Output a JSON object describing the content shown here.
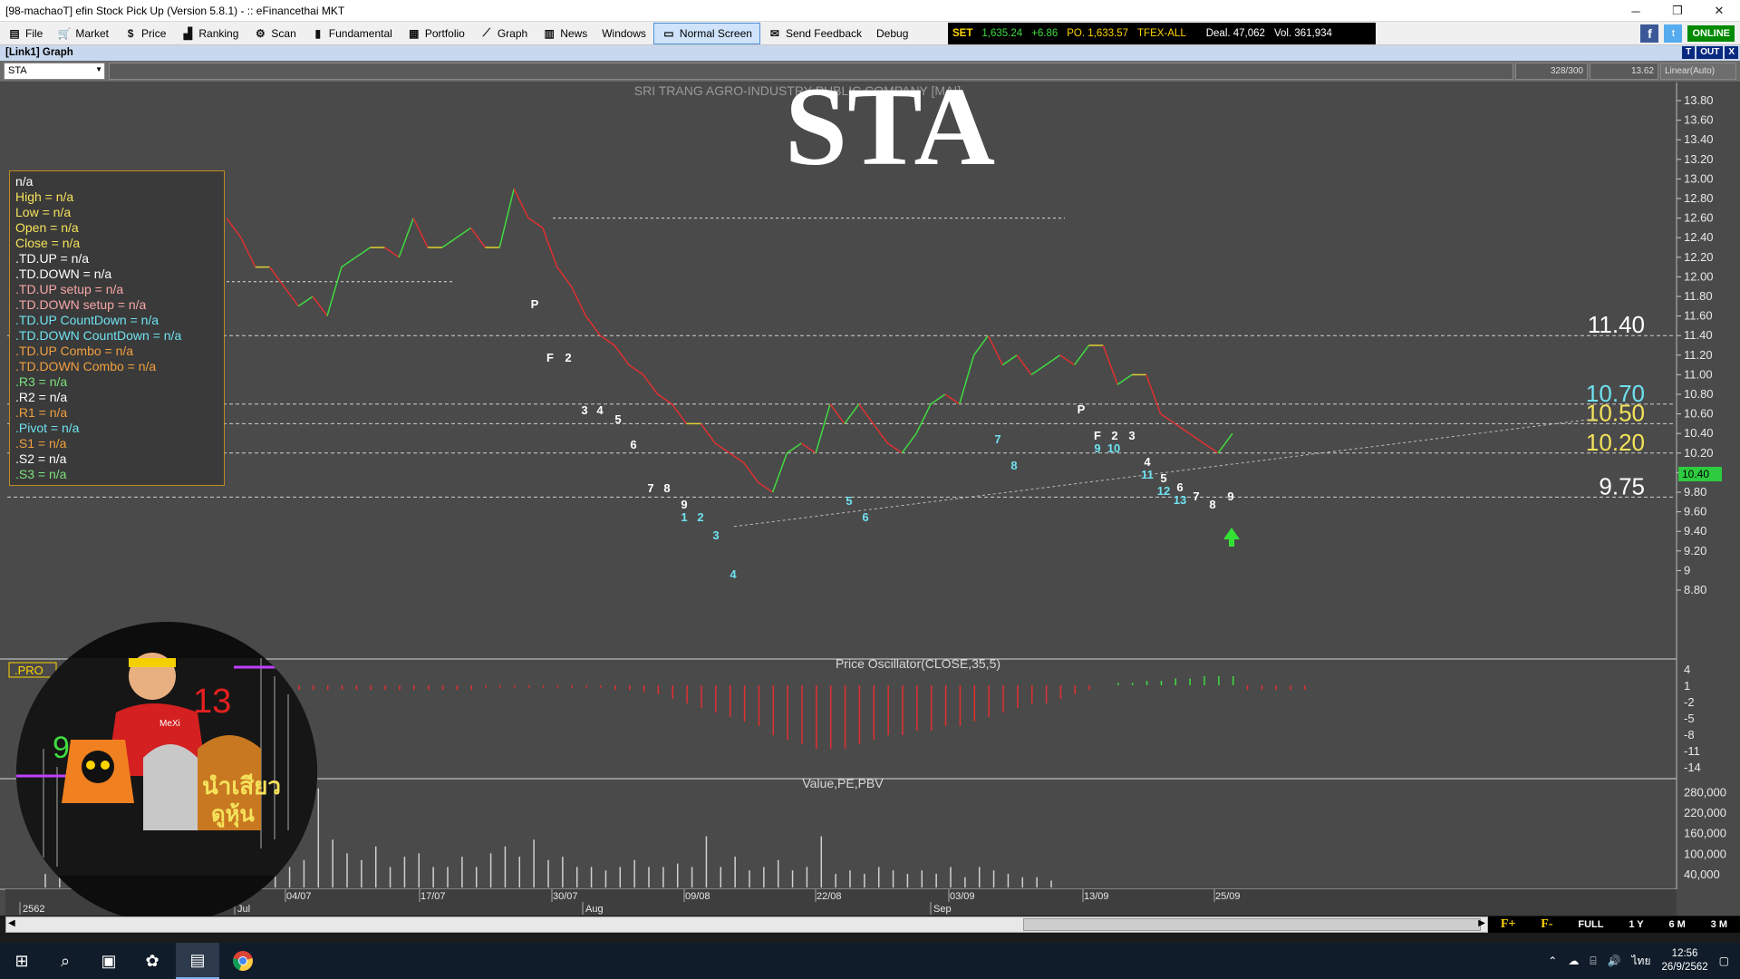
{
  "window": {
    "title": "[98-machaoT] efin Stock Pick Up (Version 5.8.1) - :: eFinancethai MKT",
    "minimize": "─",
    "maximize": "❐",
    "close": "✕"
  },
  "menu": [
    {
      "label": "File",
      "icon": "file-icon",
      "glyph": "▤"
    },
    {
      "label": "Market",
      "icon": "cart-icon",
      "glyph": "🛒"
    },
    {
      "label": "Price",
      "icon": "dollar-icon",
      "glyph": "$"
    },
    {
      "label": "Ranking",
      "icon": "ranking-icon",
      "glyph": "▟"
    },
    {
      "label": "Scan",
      "icon": "satellite-icon",
      "glyph": "⚙"
    },
    {
      "label": "Fundamental",
      "icon": "bars-icon",
      "glyph": "▮"
    },
    {
      "label": "Portfolio",
      "icon": "portfolio-icon",
      "glyph": "▦"
    },
    {
      "label": "Graph",
      "icon": "graph-icon",
      "glyph": "⟋"
    },
    {
      "label": "News",
      "icon": "news-icon",
      "glyph": "▥"
    },
    {
      "label": "Windows",
      "icon": "",
      "glyph": ""
    },
    {
      "label": "Normal Screen",
      "icon": "screen-icon",
      "glyph": "▭"
    },
    {
      "label": "Send Feedback",
      "icon": "feedback-icon",
      "glyph": "✉"
    },
    {
      "label": "Debug",
      "icon": "",
      "glyph": ""
    }
  ],
  "ticker": {
    "index": "SET",
    "value": "1,635.24",
    "change": "+6.86",
    "po": "PO. 1,633.57",
    "tfex": "TFEX-ALL",
    "deal": "Deal. 47,062",
    "vol": "Vol. 361,934"
  },
  "social": {
    "fb": "f",
    "tw": "t",
    "status": "ONLINE"
  },
  "link_title": "[Link1] Graph",
  "link_ctrls": [
    "T",
    "OUT",
    "X"
  ],
  "symbol": {
    "value": "STA",
    "dropdown": "▼"
  },
  "counter": "328/300",
  "cur_price": "13.62",
  "scale_mode": "Linear(Auto)",
  "company_name": "SRI TRANG AGRO-INDUSTRY PUBLIC COMPANY [MAI]",
  "big_symbol": "STA",
  "info_lines": [
    {
      "text": "n/a",
      "color": "#ffffff"
    },
    {
      "text": "High  = n/a",
      "color": "#f5e25a"
    },
    {
      "text": "Low  = n/a",
      "color": "#f5e25a"
    },
    {
      "text": "Open  = n/a",
      "color": "#f5e25a"
    },
    {
      "text": "Close  = n/a",
      "color": "#f5e25a"
    },
    {
      "text": ".TD.UP   = n/a",
      "color": "#ffffff"
    },
    {
      "text": ".TD.DOWN    = n/a",
      "color": "#ffffff"
    },
    {
      "text": ".TD.UP setup    = n/a",
      "color": "#f7a6a6"
    },
    {
      "text": ".TD.DOWN setup    = n/a",
      "color": "#f7a6a6"
    },
    {
      "text": ".TD.UP CountDown    = n/a",
      "color": "#6fe1f0"
    },
    {
      "text": ".TD.DOWN CountDown    = n/a",
      "color": "#6fe1f0"
    },
    {
      "text": ".TD.UP Combo    = n/a",
      "color": "#f0a040"
    },
    {
      "text": ".TD.DOWN Combo    = n/a",
      "color": "#f0a040"
    },
    {
      "text": ".R3    = n/a",
      "color": "#7de07d"
    },
    {
      "text": ".R2    = n/a",
      "color": "#ffffff"
    },
    {
      "text": ".R1    = n/a",
      "color": "#f0a040"
    },
    {
      "text": ".Pivot    = n/a",
      "color": "#6fe1f0"
    },
    {
      "text": ".S1    = n/a",
      "color": "#f0a040"
    },
    {
      "text": ".S2    = n/a",
      "color": "#ffffff"
    },
    {
      "text": ".S3    = n/a",
      "color": "#7de07d"
    }
  ],
  "price_axis": [
    "13.80",
    "13.60",
    "13.40",
    "13.20",
    "13.00",
    "12.80",
    "12.60",
    "12.40",
    "12.20",
    "12.00",
    "11.80",
    "11.60",
    "11.40",
    "11.20",
    "11.00",
    "10.80",
    "10.60",
    "10.40",
    "10.20",
    "10.00",
    "9.80",
    "9.60",
    "9.40",
    "9.20",
    "9",
    "8.80"
  ],
  "price_levels": [
    {
      "value": "11.40",
      "color": "#ffffff"
    },
    {
      "value": "10.70",
      "color": "#6fe1f0"
    },
    {
      "value": "10.50",
      "color": "#f5e25a"
    },
    {
      "value": "10.20",
      "color": "#f5e25a"
    },
    {
      "value": "9.75",
      "color": "#ffffff"
    }
  ],
  "last_price_tag": "10.40",
  "td_labels": [
    {
      "t": "P",
      "c": "#ffffff"
    },
    {
      "t": "F",
      "c": "#ffffff"
    },
    {
      "t": "2",
      "c": "#ffffff"
    },
    {
      "t": "3",
      "c": "#ffffff"
    },
    {
      "t": "4",
      "c": "#ffffff"
    },
    {
      "t": "5",
      "c": "#ffffff"
    },
    {
      "t": "6",
      "c": "#ffffff"
    },
    {
      "t": "7",
      "c": "#ffffff"
    },
    {
      "t": "8",
      "c": "#ffffff"
    },
    {
      "t": "9",
      "c": "#ffffff"
    },
    {
      "t": "1",
      "c": "#6fe1f0"
    },
    {
      "t": "2",
      "c": "#6fe1f0"
    },
    {
      "t": "3",
      "c": "#6fe1f0"
    },
    {
      "t": "4",
      "c": "#6fe1f0"
    },
    {
      "t": "5",
      "c": "#6fe1f0"
    },
    {
      "t": "6",
      "c": "#6fe1f0"
    },
    {
      "t": "7",
      "c": "#6fe1f0"
    },
    {
      "t": "8",
      "c": "#6fe1f0"
    },
    {
      "t": "P",
      "c": "#ffffff"
    },
    {
      "t": "F",
      "c": "#ffffff"
    },
    {
      "t": "2",
      "c": "#ffffff"
    },
    {
      "t": "3",
      "c": "#ffffff"
    },
    {
      "t": "9",
      "c": "#6fe1f0"
    },
    {
      "t": "10",
      "c": "#6fe1f0"
    },
    {
      "t": "4",
      "c": "#ffffff"
    },
    {
      "t": "11",
      "c": "#6fe1f0"
    },
    {
      "t": "5",
      "c": "#ffffff"
    },
    {
      "t": "12",
      "c": "#6fe1f0"
    },
    {
      "t": "6",
      "c": "#ffffff"
    },
    {
      "t": "13",
      "c": "#6fe1f0"
    },
    {
      "t": "7",
      "c": "#ffffff"
    },
    {
      "t": "8",
      "c": "#ffffff"
    },
    {
      "t": "9",
      "c": "#ffffff"
    }
  ],
  "oscillator": {
    "label": ".PRO",
    "title": "Price Oscillator(CLOSE,35,5)",
    "axis": [
      "4",
      "1",
      "-2",
      "-5",
      "-8",
      "-11",
      "-14"
    ]
  },
  "volume": {
    "label": "F",
    "title": "Value,PE,PBV",
    "axis": [
      "280,000",
      "220,000",
      "160,000",
      "100,000",
      "40,000"
    ]
  },
  "dates": [
    "04/07",
    "17/07",
    "30/07",
    "09/08",
    "22/08",
    "03/09",
    "13/09",
    "25/09"
  ],
  "months": [
    "2562",
    "Jul",
    "Aug",
    "Sep"
  ],
  "range_buttons": [
    "F+",
    "F-",
    "FULL",
    "1 Y",
    "6 M",
    "3 M"
  ],
  "mascot": {
    "num1": "13",
    "num2": "9",
    "text1": "MeXi"
  },
  "taskbar": {
    "time": "12:56",
    "date": "26/9/2562",
    "lang": "ไทย"
  },
  "chart_data": {
    "type": "line",
    "title": "STA",
    "series": [
      {
        "name": "",
        "values": [
          12.6,
          12.4,
          12.1,
          12.1,
          11.9,
          11.7,
          11.8,
          11.6,
          12.1,
          12.2,
          12.3,
          12.3,
          12.2,
          12.6,
          12.3,
          12.3,
          12.4,
          12.5,
          12.3,
          12.3,
          12.9,
          12.6,
          12.5,
          12.1,
          11.9,
          11.6,
          11.4,
          11.3,
          11.1,
          11.0,
          10.8,
          10.7,
          10.5,
          10.5,
          10.3,
          10.2,
          10.1,
          9.9,
          9.8,
          10.2,
          10.3,
          10.2,
          10.7,
          10.5,
          10.7,
          10.5,
          10.3,
          10.2,
          10.4,
          10.7,
          10.8,
          10.7,
          11.2,
          11.4,
          11.1,
          11.2,
          11.0,
          11.1,
          11.2,
          11.1,
          11.3,
          11.3,
          10.9,
          11.0,
          11.0,
          10.6,
          10.5,
          10.4,
          10.3,
          10.2,
          10.4
        ]
      }
    ],
    "ylim": [
      8.8,
      13.8
    ],
    "oscillator_values": [
      -1,
      -1,
      -1,
      -1,
      -1,
      -1,
      -1,
      -1,
      -1,
      -1,
      -1,
      -1,
      -1,
      -0.5,
      -0.5,
      -0.5,
      -0.5,
      -0.5,
      -0.5,
      -0.5,
      -0.5,
      -0.5,
      -1,
      -1,
      -1.5,
      -2,
      -3,
      -4,
      -5,
      -6,
      -7,
      -8,
      -9,
      -11,
      -12,
      -13,
      -14,
      -14,
      -14,
      -13,
      -12,
      -11,
      -11,
      -10,
      -10,
      -9,
      -9,
      -8,
      -7,
      -6,
      -5,
      -4,
      -4,
      -3,
      -2,
      -1,
      0,
      0.5,
      0.5,
      1,
      1,
      1.5,
      1.5,
      2,
      2,
      2,
      -1,
      -1,
      -1,
      -1,
      -1
    ],
    "volume_values": [
      40000,
      60000,
      80000,
      60000,
      90000,
      100000,
      60000,
      80000,
      130000,
      60000,
      100000,
      110000,
      80000,
      60000,
      90000,
      80000,
      140000,
      60000,
      80000,
      290000,
      140000,
      100000,
      80000,
      120000,
      60000,
      90000,
      100000,
      60000,
      60000,
      90000,
      60000,
      100000,
      120000,
      90000,
      140000,
      80000,
      90000,
      60000,
      60000,
      50000,
      60000,
      80000,
      60000,
      60000,
      70000,
      60000,
      150000,
      60000,
      90000,
      50000,
      60000,
      80000,
      50000,
      60000,
      150000,
      40000,
      50000,
      40000,
      60000,
      50000,
      40000,
      50000,
      40000,
      60000,
      30000,
      60000,
      50000,
      40000,
      30000,
      30000,
      20000
    ]
  }
}
